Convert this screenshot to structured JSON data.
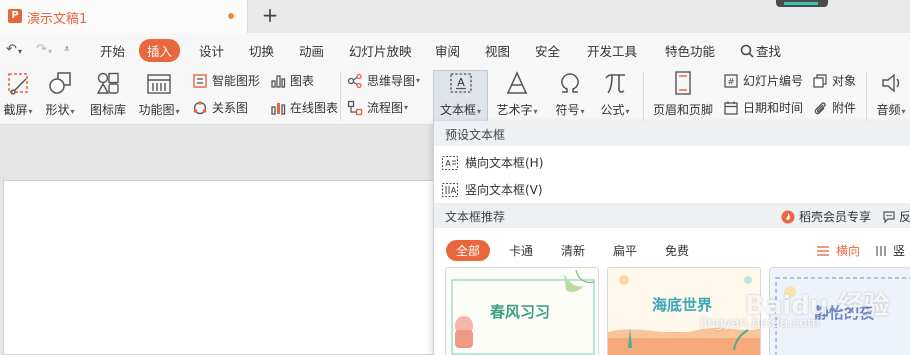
{
  "titlebar": {
    "doc_logo": "P",
    "doc_title": "演示文稿1",
    "new_tab": "+"
  },
  "menu": {
    "items": [
      "开始",
      "插入",
      "设计",
      "切换",
      "动画",
      "幻灯片放映",
      "审阅",
      "视图",
      "安全",
      "开发工具",
      "特色功能"
    ],
    "active": "插入",
    "search": "查找"
  },
  "ribbon": {
    "screenshot": "截屏",
    "shape": "形状",
    "icon_lib": "图标库",
    "func_chart": "功能图",
    "smart_shape": "智能图形",
    "chart": "图表",
    "relation": "关系图",
    "online_chart": "在线图表",
    "mindmap": "思维导图",
    "flowchart": "流程图",
    "textbox": "文本框",
    "wordart": "艺术字",
    "symbol": "符号",
    "formula": "公式",
    "header_footer": "页眉和页脚",
    "slide_number": "幻灯片编号",
    "object": "对象",
    "datetime": "日期和时间",
    "attachment": "附件",
    "audio": "音频"
  },
  "dropdown": {
    "preset_header": "预设文本框",
    "horizontal": "横向文本框(H)",
    "vertical": "竖向文本框(V)",
    "recommend_header": "文本框推荐",
    "member": "稻壳会员专享",
    "feedback": "反",
    "filters": [
      "全部",
      "卡通",
      "清新",
      "扁平",
      "免费"
    ],
    "orient_h": "横向",
    "orient_v": "竖",
    "cards": [
      "春风习习",
      "海底世界",
      "静怡的夜"
    ]
  },
  "watermark": {
    "main": "Baidu 经验",
    "sub": "jingyan.baidu.com"
  },
  "colors": {
    "accent": "#e8673c",
    "selected_bg": "#dfe3ea"
  }
}
